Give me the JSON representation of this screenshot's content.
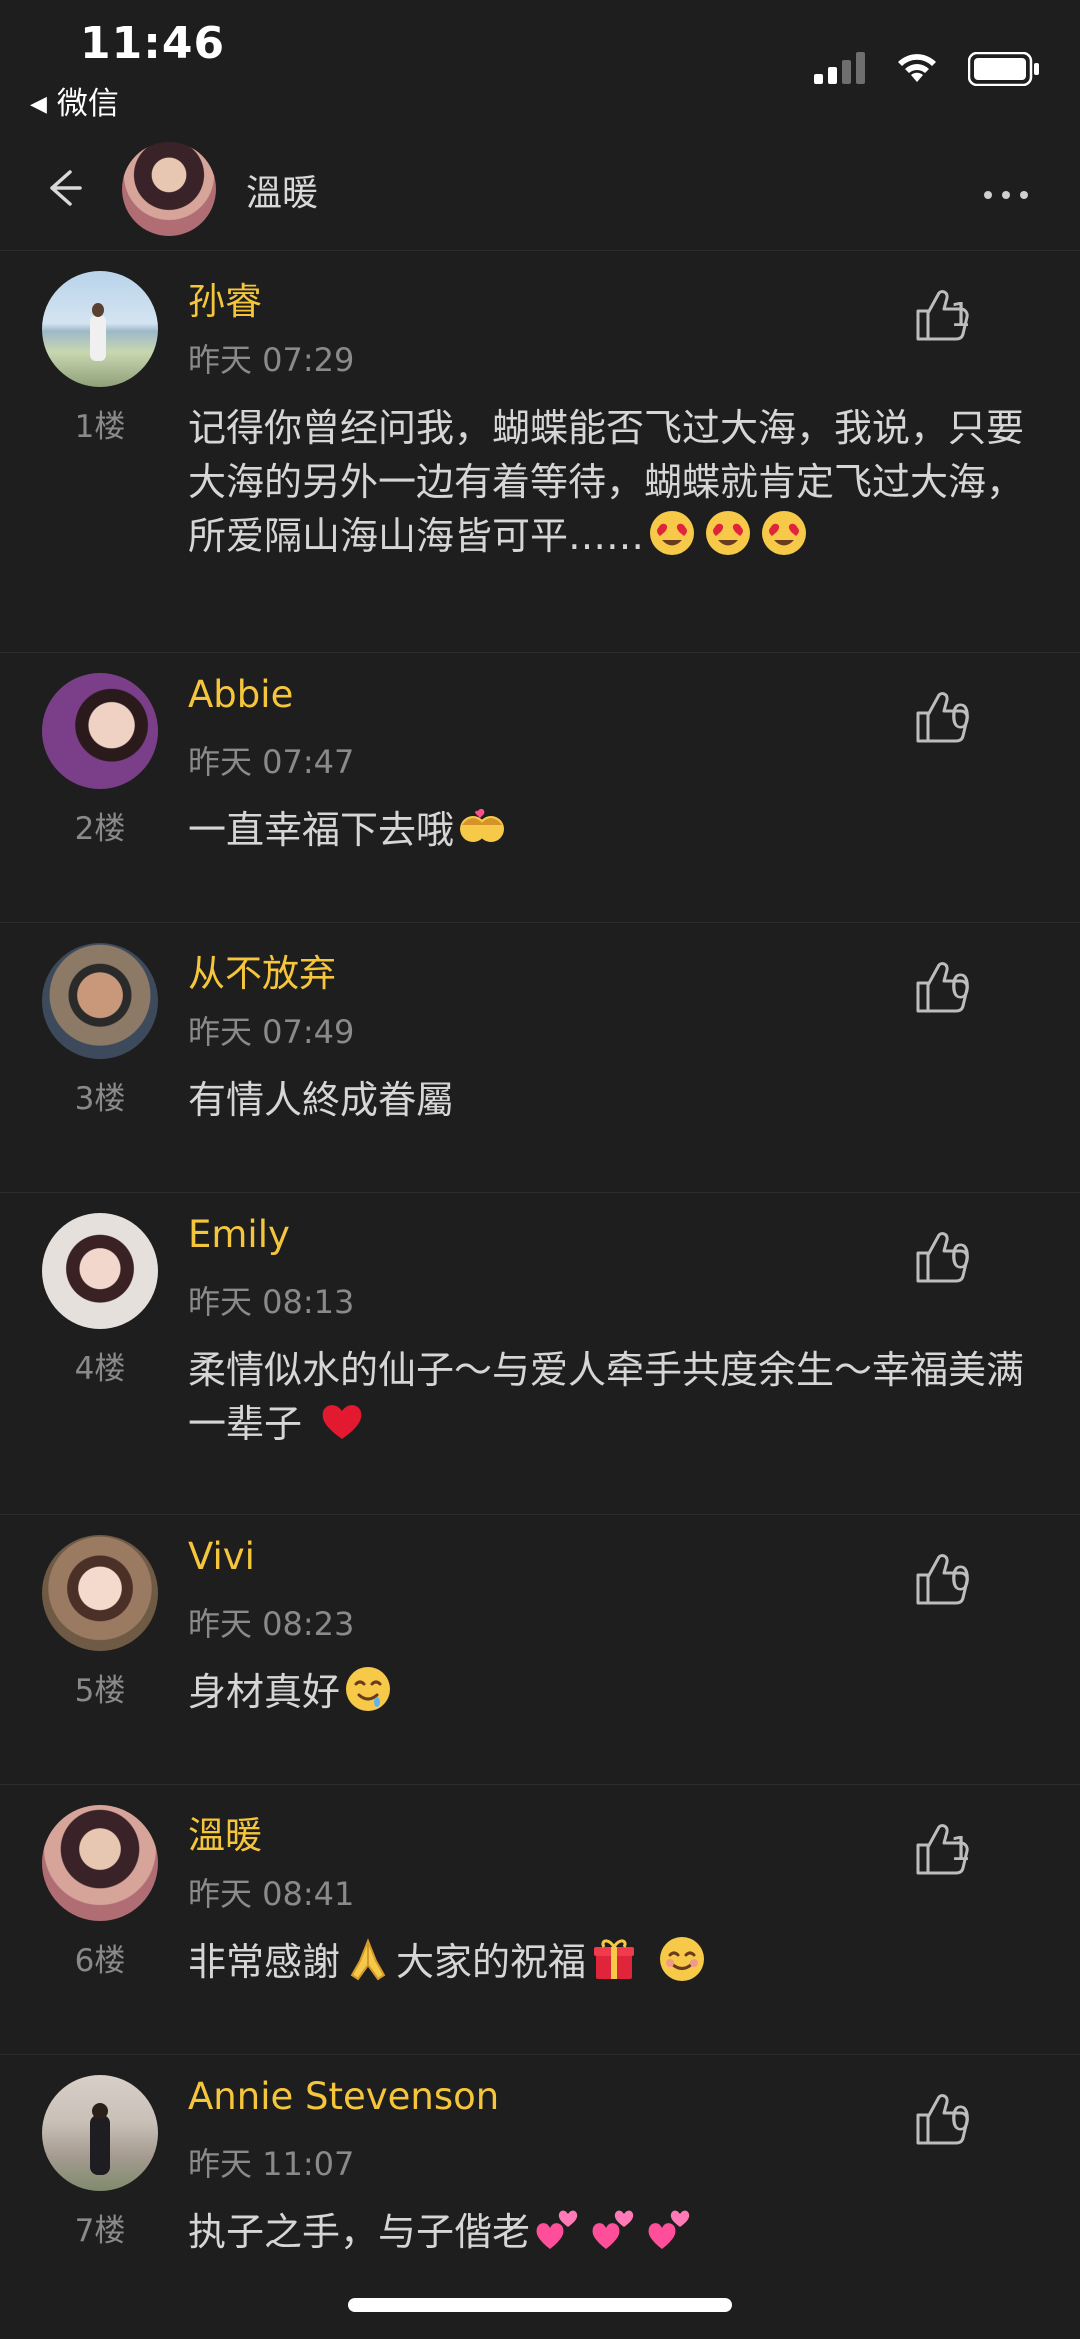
{
  "status_bar": {
    "time": "11:46",
    "back_app": "微信"
  },
  "header": {
    "title": "溫暖"
  },
  "comments": [
    {
      "name": "孙睿",
      "time": "昨天 07:29",
      "floor": "1楼",
      "likes": "1",
      "text": "记得你曾经问我，蝴蝶能否飞过大海，我说，只要大海的另外一边有着等待，蝴蝶就肯定飞过大海，所爱隔山海山海皆可平……",
      "emojis": [
        "heart-eyes",
        "heart-eyes",
        "heart-eyes"
      ]
    },
    {
      "name": "Abbie",
      "time": "昨天 07:47",
      "floor": "2楼",
      "likes": "0",
      "text": "一直幸福下去哦",
      "emojis": [
        "couple-kiss"
      ]
    },
    {
      "name": "从不放弃",
      "time": "昨天 07:49",
      "floor": "3楼",
      "likes": "0",
      "text": "有情人終成眷屬",
      "emojis": []
    },
    {
      "name": "Emily",
      "time": "昨天 08:13",
      "floor": "4楼",
      "likes": "0",
      "text": "柔情似水的仙子～与爱人牵手共度余生～幸福美满一辈子 ",
      "emojis": [
        "red-heart"
      ]
    },
    {
      "name": "Vivi",
      "time": "昨天 08:23",
      "floor": "5楼",
      "likes": "0",
      "text": "身材真好",
      "emojis": [
        "drooling-face"
      ]
    },
    {
      "name": "溫暖",
      "time": "昨天 08:41",
      "floor": "6楼",
      "likes": "1",
      "text_a": "非常感謝",
      "text_b": "大家的祝福",
      "emojis": [
        "folded-hands",
        "gift",
        "smiling-face"
      ]
    },
    {
      "name": "Annie Stevenson",
      "time": "昨天 11:07",
      "floor": "7楼",
      "likes": "0",
      "text": "执子之手，与子偕老",
      "emojis": [
        "two-hearts",
        "two-hearts",
        "two-hearts"
      ]
    }
  ],
  "colors": {
    "background": "#1e1e1e",
    "name": "#f5c63c",
    "muted": "#8a8a8a",
    "text": "#d6d6d6"
  }
}
